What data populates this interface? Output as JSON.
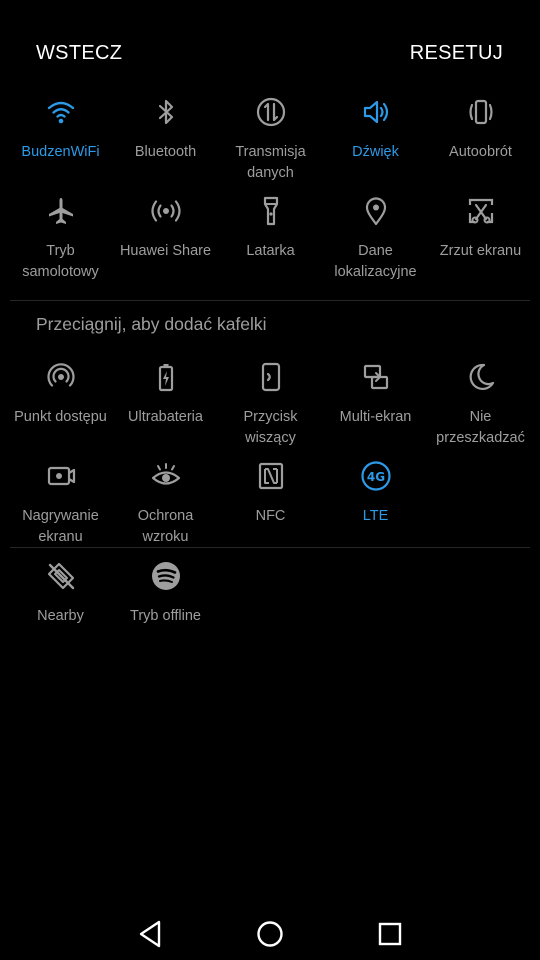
{
  "header": {
    "back_label": "WSTECZ",
    "reset_label": "RESETUJ"
  },
  "colors": {
    "active": "#2d9ae8",
    "inactive": "#9e9e9e",
    "background": "#000000"
  },
  "active_tiles": [
    {
      "label": "BudzenWiFi",
      "icon": "wifi-icon",
      "active": true
    },
    {
      "label": "Bluetooth",
      "icon": "bluetooth-icon",
      "active": false
    },
    {
      "label": "Transmisja danych",
      "icon": "mobile-data-icon",
      "active": false
    },
    {
      "label": "Dźwięk",
      "icon": "sound-icon",
      "active": true
    },
    {
      "label": "Autoobrót",
      "icon": "auto-rotate-icon",
      "active": false
    },
    {
      "label": "Tryb samolotowy",
      "icon": "airplane-icon",
      "active": false
    },
    {
      "label": "Huawei Share",
      "icon": "huawei-share-icon",
      "active": false
    },
    {
      "label": "Latarka",
      "icon": "flashlight-icon",
      "active": false
    },
    {
      "label": "Dane lokalizacyjne",
      "icon": "location-icon",
      "active": false
    },
    {
      "label": "Zrzut ekranu",
      "icon": "screenshot-icon",
      "active": false
    }
  ],
  "available_section": {
    "title": "Przeciągnij, aby dodać kafelki"
  },
  "available_tiles": [
    {
      "label": "Punkt dostępu",
      "icon": "hotspot-icon",
      "active": false
    },
    {
      "label": "Ultrabateria",
      "icon": "ultra-battery-icon",
      "active": false
    },
    {
      "label": "Przycisk wiszący",
      "icon": "floating-button-icon",
      "active": false
    },
    {
      "label": "Multi-ekran",
      "icon": "multi-screen-icon",
      "active": false
    },
    {
      "label": "Nie przeszkadzać",
      "icon": "do-not-disturb-icon",
      "active": false
    },
    {
      "label": "Nagrywanie ekranu",
      "icon": "screen-record-icon",
      "active": false
    },
    {
      "label": "Ochrona wzroku",
      "icon": "eye-comfort-icon",
      "active": false
    },
    {
      "label": "NFC",
      "icon": "nfc-icon",
      "active": false
    },
    {
      "label": "LTE",
      "icon": "lte-4g-icon",
      "active": true
    }
  ],
  "extra_tiles": [
    {
      "label": "Nearby",
      "icon": "nearby-icon",
      "active": false
    },
    {
      "label": "Tryb offline",
      "icon": "spotify-icon",
      "active": false
    }
  ],
  "navbar": {
    "back": "nav-back-icon",
    "home": "nav-home-icon",
    "recents": "nav-recents-icon"
  }
}
